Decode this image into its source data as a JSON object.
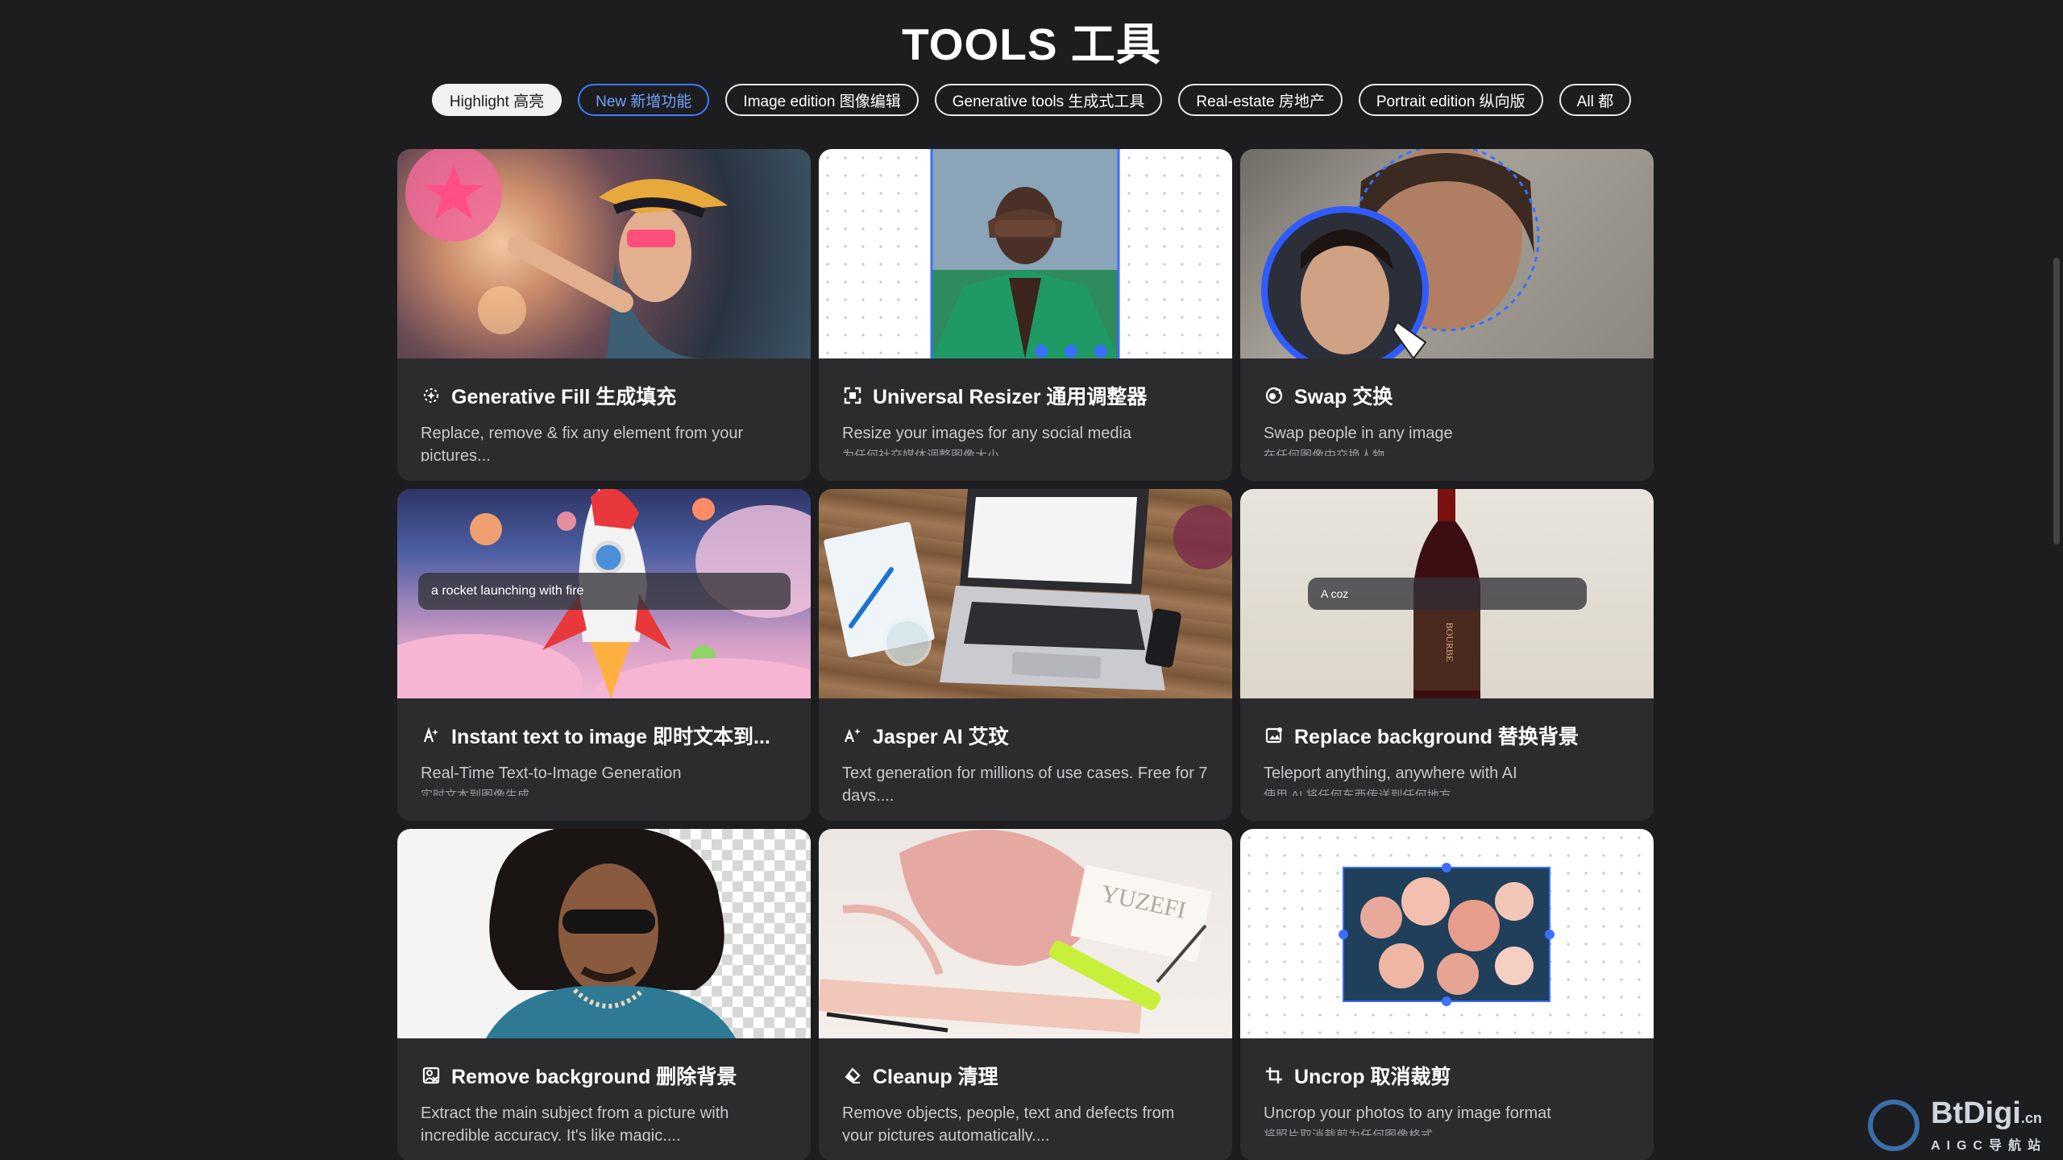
{
  "page": {
    "title": "TOOLS 工具"
  },
  "filters": [
    {
      "label": "Highlight 高亮",
      "state": "active"
    },
    {
      "label": "New 新增功能",
      "state": "new"
    },
    {
      "label": "Image edition 图像编辑",
      "state": ""
    },
    {
      "label": "Generative tools 生成式工具",
      "state": ""
    },
    {
      "label": "Real-estate 房地产",
      "state": ""
    },
    {
      "label": "Portrait edition 纵向版",
      "state": ""
    },
    {
      "label": "All 都",
      "state": ""
    }
  ],
  "cards": [
    {
      "title": "Generative Fill 生成填充",
      "icon": "sparkle-icon",
      "desc": "Replace, remove & fix any element from your pictures...",
      "sub": ""
    },
    {
      "title": "Universal Resizer 通用调整器",
      "icon": "resize-icon",
      "desc": "Resize your images for any social media",
      "sub": "为任何社交媒体调整图像大小"
    },
    {
      "title": "Swap 交换",
      "icon": "swap-icon",
      "desc": "Swap people in any image",
      "sub": "在任何图像中交换人物"
    },
    {
      "title": "Instant text to image 即时文本到...",
      "icon": "text-to-image-icon",
      "desc": "Real-Time Text-to-Image Generation",
      "sub": "实时文本到图像生成",
      "prompt": "a rocket launching with fire"
    },
    {
      "title": "Jasper AI 艾玟",
      "icon": "ai-sparkle-icon",
      "desc": "Text generation for millions of use cases. Free for 7 days....",
      "sub": ""
    },
    {
      "title": "Replace background 替换背景",
      "icon": "replace-bg-icon",
      "desc": "Teleport anything, anywhere with AI",
      "sub": "使用 AI 将任何东西传送到任何地方",
      "prompt": "A coz"
    },
    {
      "title": "Remove background 删除背景",
      "icon": "remove-bg-icon",
      "desc": "Extract the main subject from a picture with incredible accuracy. It's like magic....",
      "sub": ""
    },
    {
      "title": "Cleanup 清理",
      "icon": "eraser-icon",
      "desc": "Remove objects, people, text and defects from your pictures automatically....",
      "sub": ""
    },
    {
      "title": "Uncrop 取消裁剪",
      "icon": "uncrop-icon",
      "desc": "Uncrop your photos to any image format",
      "sub": "将照片取消裁剪为任何图像格式"
    }
  ],
  "brand": {
    "name": "BtDigi",
    "suffix": ".cn",
    "tagline": "AIGC导航站"
  }
}
